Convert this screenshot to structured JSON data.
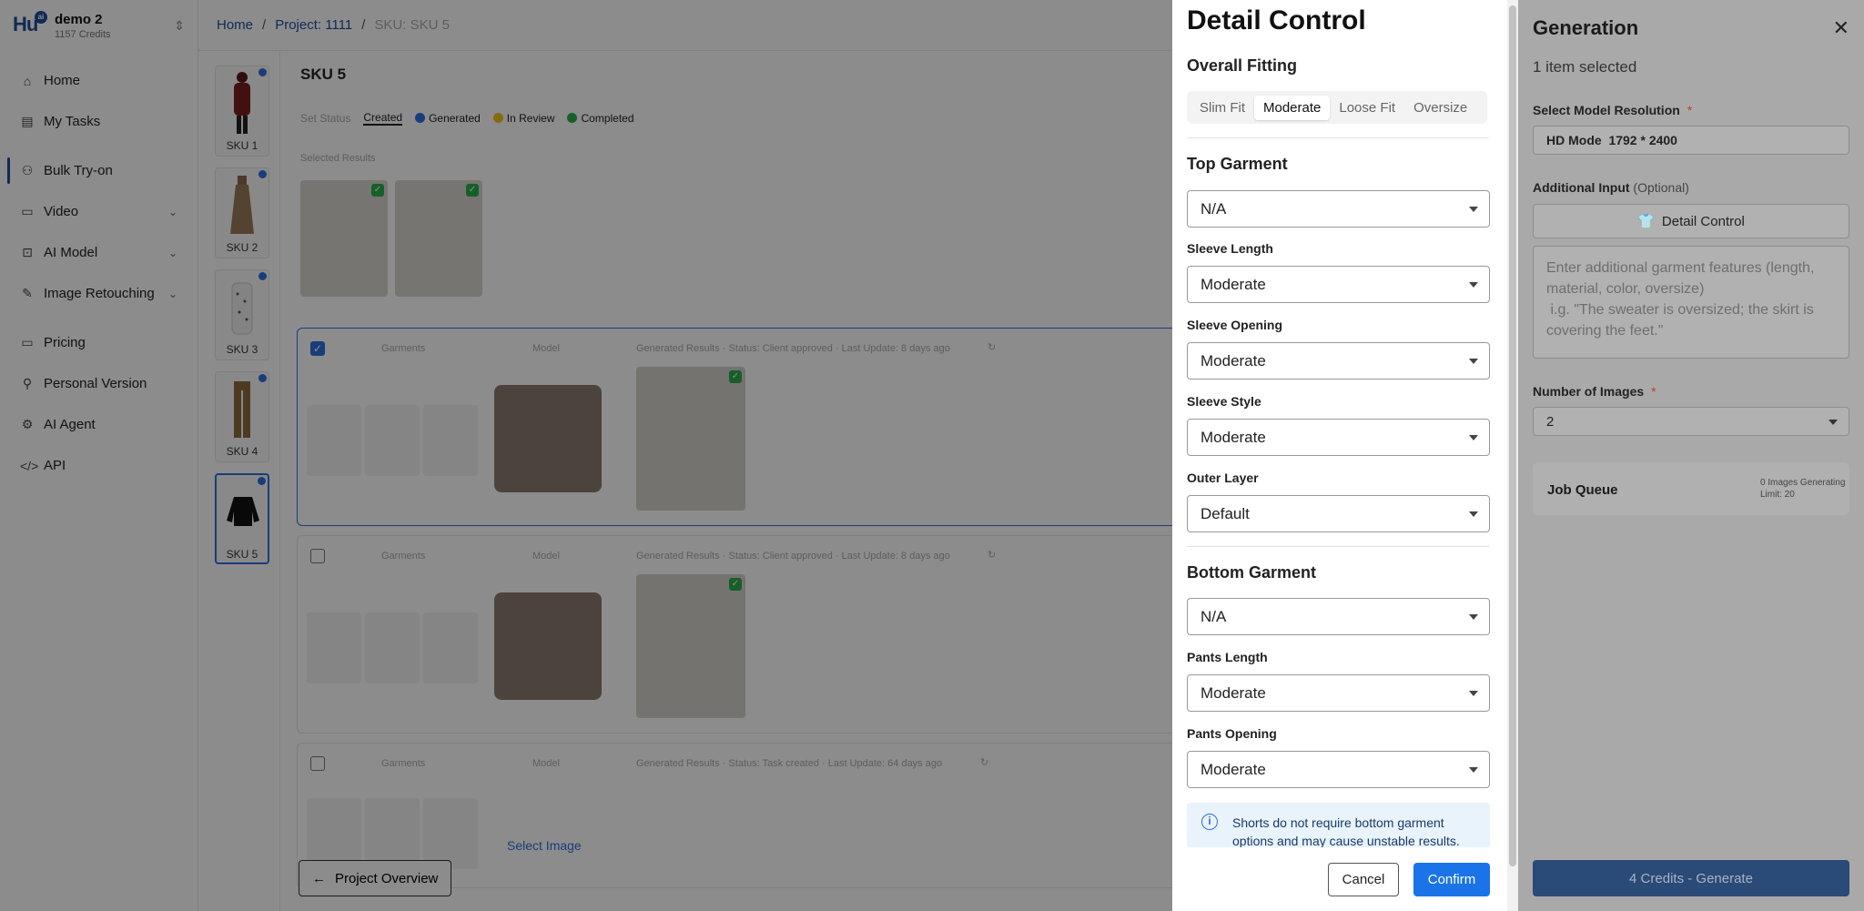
{
  "workspace": {
    "logo": "Hu",
    "logo_badge": "ai",
    "name": "demo 2",
    "credits": "1157 Credits"
  },
  "sidebar": {
    "items": [
      {
        "label": "Home",
        "icon": "home-icon"
      },
      {
        "label": "My Tasks",
        "icon": "tasks-icon"
      },
      {
        "label": "Bulk Try-on",
        "icon": "bulk-tryon-icon"
      },
      {
        "label": "Video",
        "icon": "video-icon"
      },
      {
        "label": "AI Model",
        "icon": "ai-model-icon"
      },
      {
        "label": "Image Retouching",
        "icon": "brush-icon"
      },
      {
        "label": "Pricing",
        "icon": "pricing-icon"
      },
      {
        "label": "Personal Version",
        "icon": "person-icon"
      },
      {
        "label": "AI Agent",
        "icon": "agent-icon"
      },
      {
        "label": "API",
        "icon": "code-icon"
      }
    ]
  },
  "breadcrumb": {
    "home": "Home",
    "project": "Project: 1111",
    "current": "SKU: SKU 5"
  },
  "skus": [
    "SKU 1",
    "SKU 2",
    "SKU 3",
    "SKU 4",
    "SKU 5"
  ],
  "main": {
    "title": "SKU 5",
    "status_label": "Set Status",
    "statuses": {
      "created": "Created",
      "generated": "Generated",
      "in_review": "In Review",
      "completed": "Completed"
    },
    "status_colors": {
      "generated": "#2f6fde",
      "in_review": "#f0c419",
      "completed": "#28b04a"
    },
    "selected_results_label": "Selected Results",
    "col_garments": "Garments",
    "col_model": "Model",
    "cards": [
      {
        "meta": "Generated Results · Status: Client approved · Last Update: 8 days ago"
      },
      {
        "meta": "Generated Results · Status: Client approved · Last Update: 8 days ago"
      },
      {
        "meta": "Generated Results · Status: Task created · Last Update: 64 days ago"
      }
    ],
    "select_image": "Select Image",
    "project_overview": "Project Overview"
  },
  "detail": {
    "title": "Detail Control",
    "overall_fitting": "Overall Fitting",
    "fits": [
      "Slim Fit",
      "Moderate",
      "Loose Fit",
      "Oversize"
    ],
    "fit_selected": "Moderate",
    "top_garment": "Top Garment",
    "top_value": "N/A",
    "sleeve_length": {
      "label": "Sleeve Length",
      "value": "Moderate"
    },
    "sleeve_opening": {
      "label": "Sleeve Opening",
      "value": "Moderate"
    },
    "sleeve_style": {
      "label": "Sleeve Style",
      "value": "Moderate"
    },
    "outer_layer": {
      "label": "Outer Layer",
      "value": "Default"
    },
    "bottom_garment": "Bottom Garment",
    "bottom_value": "N/A",
    "pants_length": {
      "label": "Pants Length",
      "value": "Moderate"
    },
    "pants_opening": {
      "label": "Pants Opening",
      "value": "Moderate"
    },
    "info": "Shorts do not require bottom garment options and may cause unstable results.",
    "cancel": "Cancel",
    "confirm": "Confirm"
  },
  "generation": {
    "title": "Generation",
    "selected": "1 item selected",
    "resolution_label": "Select Model Resolution",
    "required_mark": "*",
    "resolution_mode": "HD Mode",
    "resolution_value": "1792 * 2400",
    "additional_label": "Additional Input",
    "optional": "(Optional)",
    "detail_button": "Detail Control",
    "placeholder": "Enter additional garment features (length, material, color, oversize)\n i.g. \"The sweater is oversized; the skirt is covering the feet.\"",
    "num_images_label": "Number of Images",
    "num_images": "2",
    "job_queue": "Job Queue",
    "job_generating": "0 Images Generating",
    "job_limit": "Limit: 20",
    "generate": "4 Credits - Generate"
  }
}
